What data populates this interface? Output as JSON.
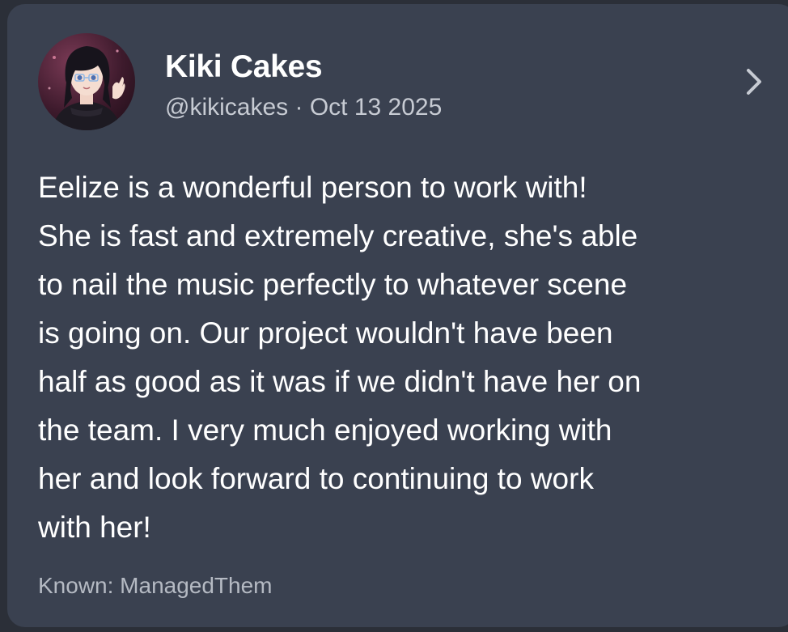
{
  "post": {
    "author_name": "Kiki Cakes",
    "handle": "@kikicakes",
    "separator": " · ",
    "date": "Oct 13 2025",
    "avatar_icon": "anime-girl-avatar",
    "open_icon": "chevron-right-icon",
    "body_lines": [
      "Eelize is a wonderful person to work with!",
      "She is fast and extremely creative, she's able",
      "to nail the music perfectly to whatever scene",
      "is going on. Our project wouldn't have been",
      "half as good as it was if we didn't have her on",
      "the team. I very much enjoyed working with",
      "her and look forward to continuing to work",
      "with her!"
    ],
    "known": "Known: ManagedThem"
  },
  "colors": {
    "card_background": "#3a4150",
    "text_primary": "#ffffff",
    "text_secondary": "#c7cbd3"
  }
}
